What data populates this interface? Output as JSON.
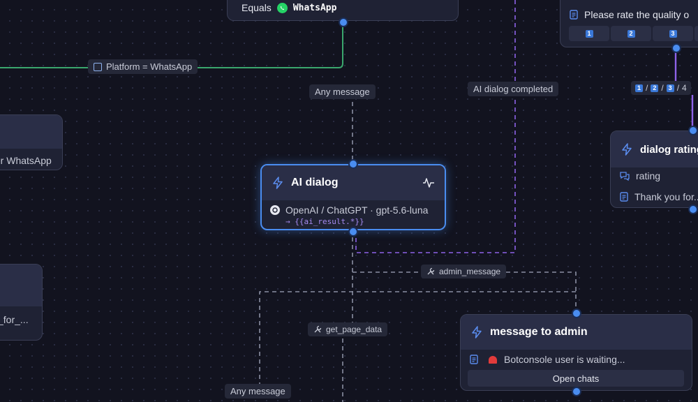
{
  "colors": {
    "accent": "#4a8df0",
    "green_wire": "#3aa76d",
    "purple_wire": "#8e63e8",
    "gray_wire": "#8a8fa3"
  },
  "top_node": {
    "equals_label": "Equals",
    "platform": "WhatsApp"
  },
  "edge_labels": {
    "platform_condition": "Platform = WhatsApp",
    "any_message_top": "Any message",
    "ai_dialog_completed": "AI dialog completed",
    "admin_message": "admin_message",
    "get_page_data": "get_page_data",
    "any_message_bottom": "Any message",
    "rating_options": [
      "1",
      "/",
      "2",
      "/",
      "3",
      "/",
      "4"
    ]
  },
  "left_node_1": {
    "subtitle": "for WhatsApp"
  },
  "left_node_2": {
    "subtitle": "_for_..."
  },
  "ai_dialog": {
    "title": "AI dialog",
    "provider": "OpenAI / ChatGPT · gpt-5.6-luna",
    "result_var": "→ {{ai_result.*}}"
  },
  "rate_node": {
    "text": "Please rate the quality o",
    "buttons": [
      "1",
      "2",
      "3"
    ]
  },
  "dialog_rating": {
    "title": "dialog rating",
    "row1": "rating",
    "row2": "Thank you for..."
  },
  "admin_node": {
    "title": "message to admin",
    "text": "Botconsole user is waiting...",
    "button": "Open chats"
  }
}
